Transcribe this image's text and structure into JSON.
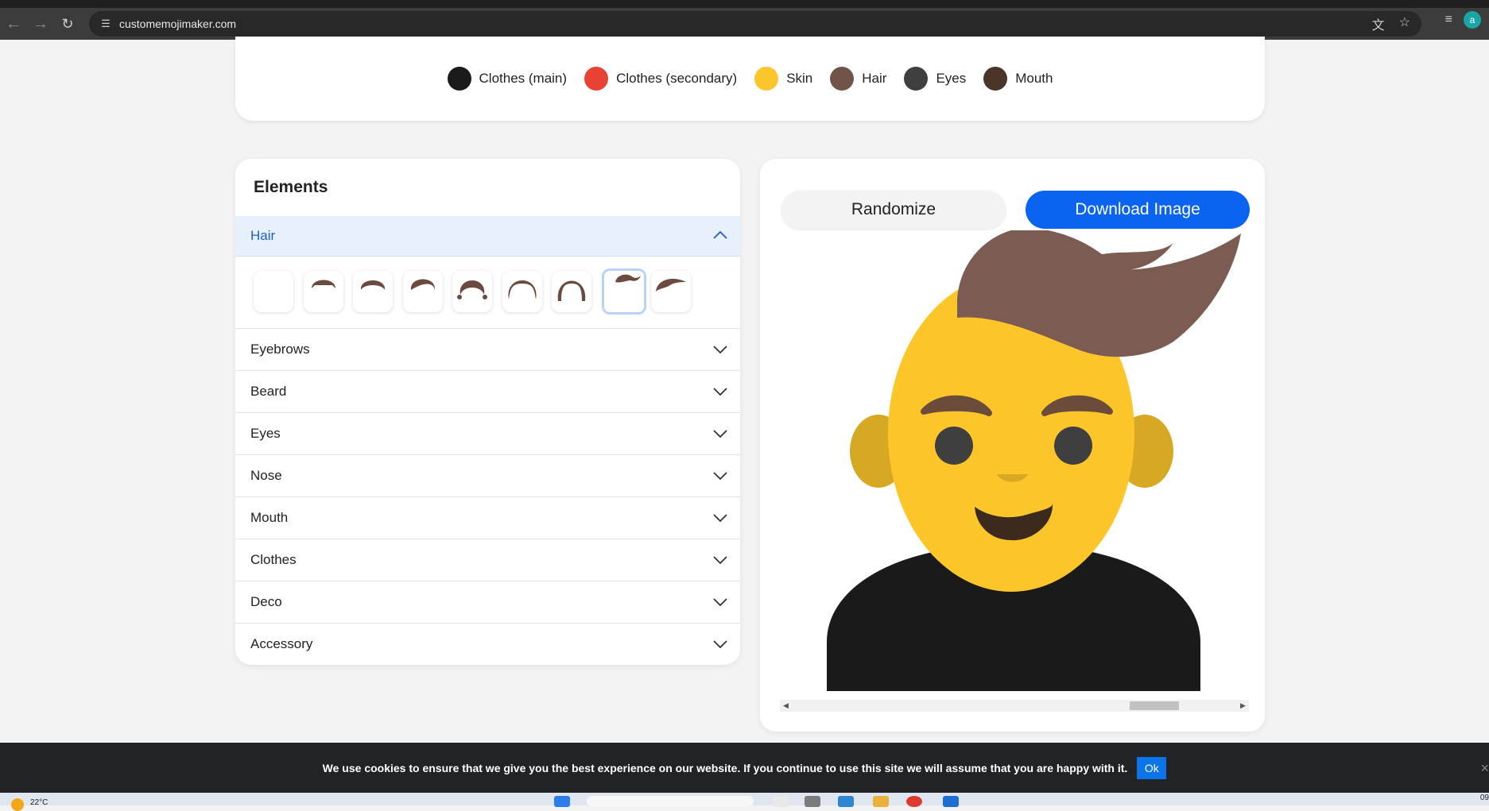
{
  "browser": {
    "url": "customemojimaker.com",
    "icons": [
      "back-arrow-icon",
      "forward-arrow-icon",
      "reload-icon",
      "site-settings-icon",
      "translate-icon",
      "star-icon",
      "media-queue-icon"
    ],
    "profile_initial": "a"
  },
  "colors": [
    {
      "label": "Clothes (main)",
      "color": "#1b1b1b"
    },
    {
      "label": "Clothes (secondary)",
      "color": "#e94234"
    },
    {
      "label": "Skin",
      "color": "#fbc52c"
    },
    {
      "label": "Hair",
      "color": "#70544a"
    },
    {
      "label": "Eyes",
      "color": "#3f3f3f"
    },
    {
      "label": "Mouth",
      "color": "#4a3528"
    }
  ],
  "elements": {
    "title": "Elements",
    "open_section": "Hair",
    "hair_option_count": 9,
    "hair_selected_index": 7,
    "sections": [
      "Eyebrows",
      "Beard",
      "Eyes",
      "Nose",
      "Mouth",
      "Clothes",
      "Deco",
      "Accessory"
    ]
  },
  "preview": {
    "randomize_label": "Randomize",
    "download_label": "Download Image",
    "hair_color": "#7c5c52",
    "skin_color": "#fcc62a",
    "ear_color": "#d7a824",
    "clothes_color": "#1a1a1a",
    "eye_color": "#3f3f3f",
    "mouth_color": "#3d2a1f",
    "brow_color": "#6b4c3b"
  },
  "cookie": {
    "message": "We use cookies to ensure that we give you the best experience on our website. If you continue to use this site we will assume that you are happy with it.",
    "ok_label": "Ok",
    "close": "×"
  },
  "taskbar": {
    "weather": "22°C",
    "clock": "09"
  }
}
